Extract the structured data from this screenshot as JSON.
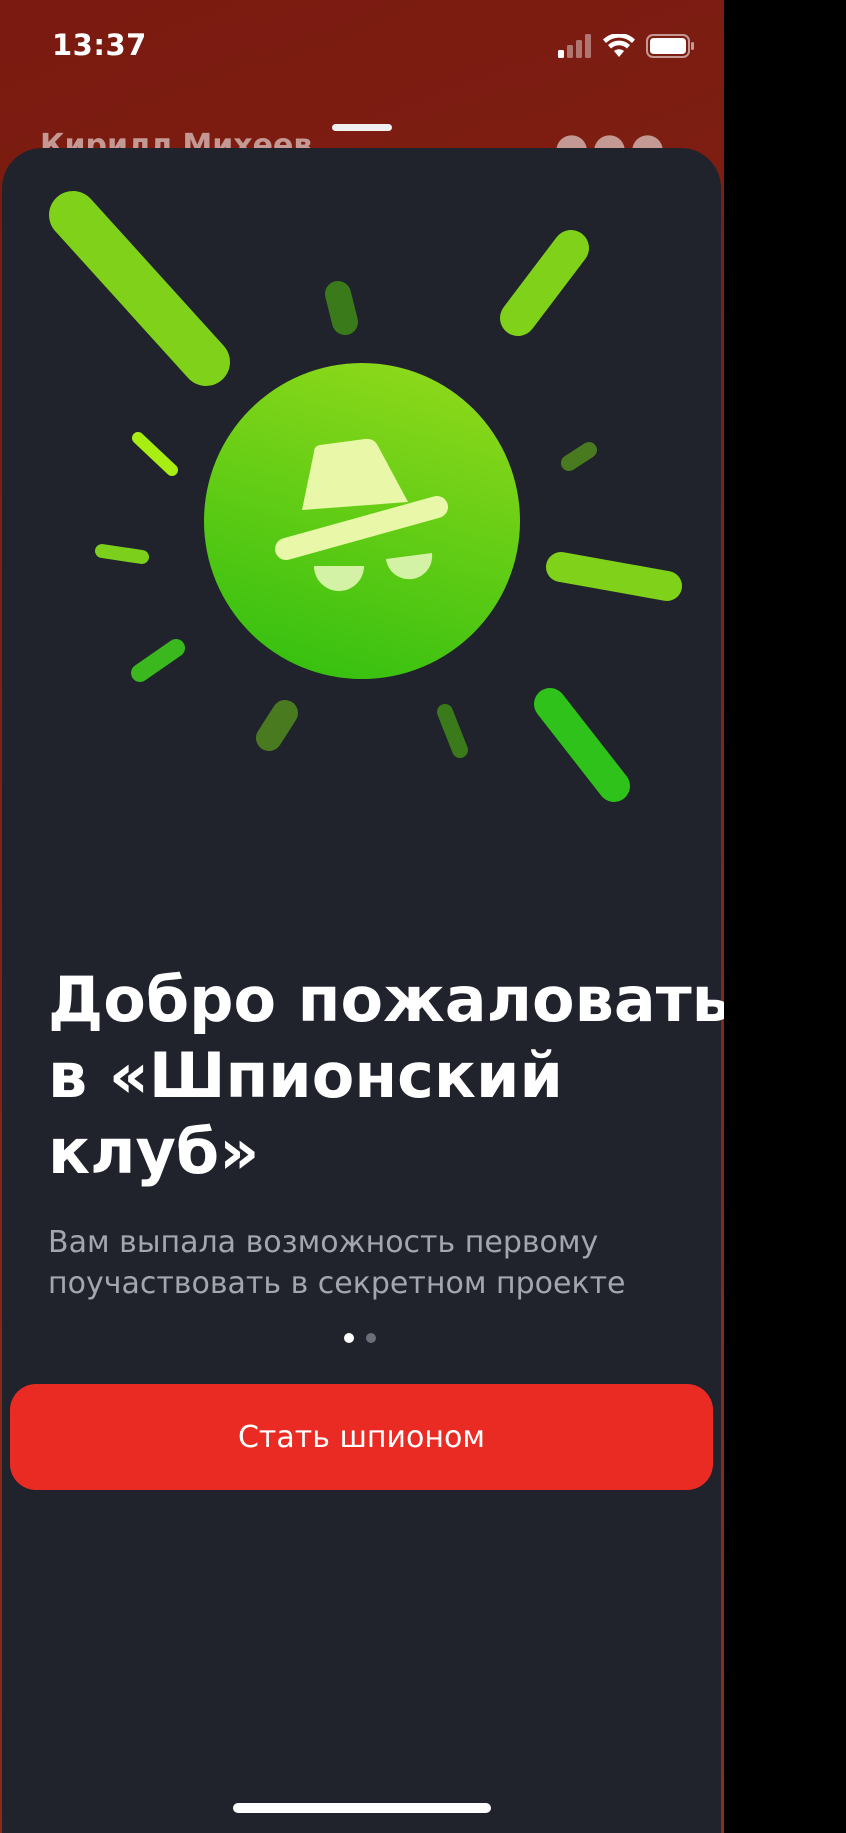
{
  "status_bar": {
    "time": "13:37",
    "signal_icon": "cellular-signal-icon",
    "wifi_icon": "wifi-icon",
    "battery_icon": "battery-icon"
  },
  "background_screen": {
    "contact_name": "Кирилл Михеев",
    "more_icon": "more-dots-icon"
  },
  "sheet": {
    "illustration_icon": "spy-hat-glasses-icon",
    "title_lines": [
      "Добро пожаловать",
      "в «Шпионский",
      "клуб»"
    ],
    "subtitle_lines": [
      "Вам выпала возможность первому",
      "поучаствовать в секретном проекте"
    ],
    "pager": {
      "current": 1,
      "total": 2
    },
    "cta_label": "Стать шпионом"
  },
  "colors": {
    "sheet_background": "#20222c",
    "accent_green": "#5cc81a",
    "cta_red": "#ea2b23",
    "subtitle_gray": "#a4a6ae"
  }
}
